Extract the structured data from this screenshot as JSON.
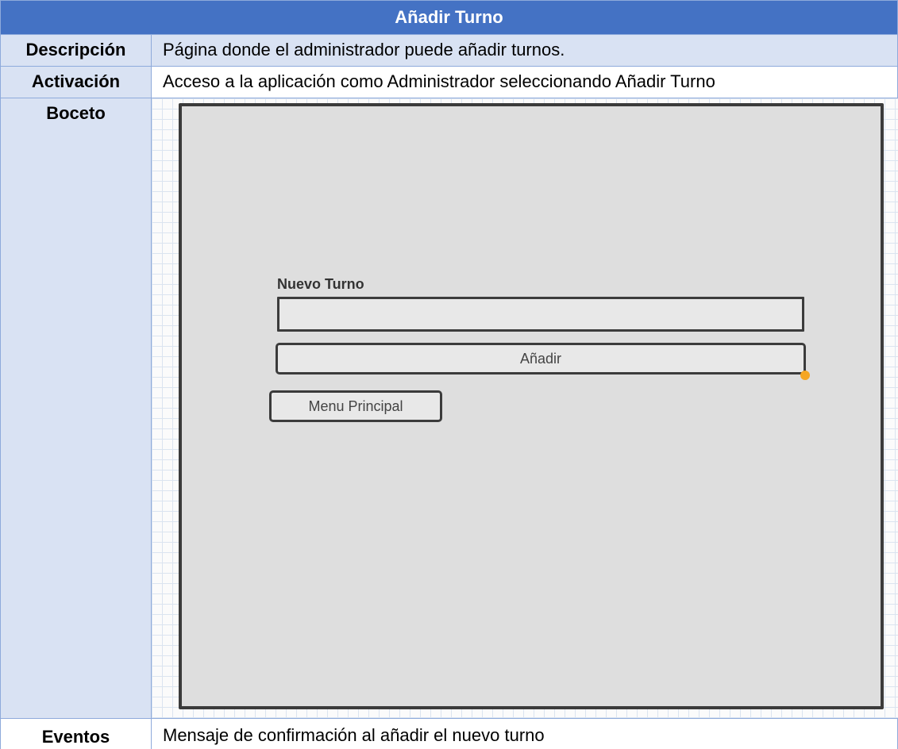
{
  "title": "Añadir Turno",
  "rows": {
    "descripcion": {
      "label": "Descripción",
      "value": "Página donde el administrador puede añadir turnos."
    },
    "activacion": {
      "label": "Activación",
      "value": "Acceso a la aplicación como Administrador seleccionando Añadir Turno"
    },
    "boceto": {
      "label": "Boceto"
    },
    "eventos": {
      "label": "Eventos",
      "value": "Mensaje de confirmación al añadir el nuevo turno"
    }
  },
  "sketch": {
    "field_label": "Nuevo Turno",
    "input_value": "",
    "add_button_label": "Añadir",
    "menu_button_label": "Menu Principal"
  },
  "colors": {
    "header_blue": "#4472c4",
    "row_shade": "#d9e2f3",
    "border": "#8eaadb",
    "sketch_bg": "#dedede",
    "handle_orange": "#f5a623"
  }
}
